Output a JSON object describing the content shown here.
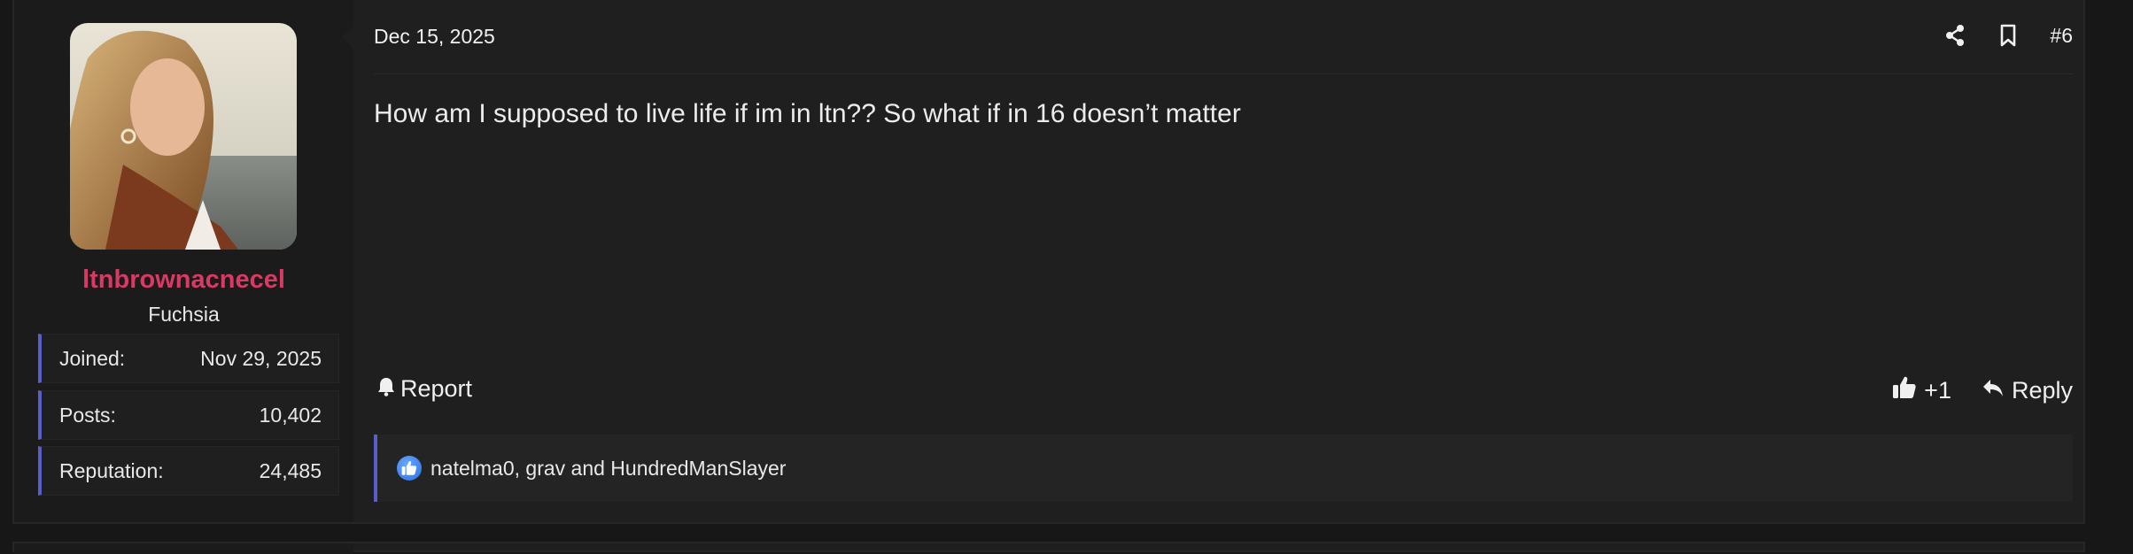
{
  "post": {
    "date": "Dec 15, 2025",
    "number": "#6",
    "body": "How am I supposed to live life if im in ltn?? So what if in 16 doesn’t matter",
    "actions": {
      "report_label": "Report",
      "like_label": "+1",
      "reply_label": "Reply"
    },
    "reactions_text": "natelma0, grav and HundredManSlayer"
  },
  "user": {
    "username": "ltnbrownacnecel",
    "title": "Fuchsia",
    "stats": [
      {
        "label": "Joined:",
        "value": "Nov 29, 2025"
      },
      {
        "label": "Posts:",
        "value": "10,402"
      },
      {
        "label": "Reputation:",
        "value": "24,485"
      }
    ]
  },
  "colors": {
    "username": "#d93a63",
    "accent_border": "#5a5ec9",
    "reaction_like": "#3a86f0"
  },
  "icons": [
    "share-icon",
    "bookmark-icon",
    "bell-icon",
    "thumbs-up-icon",
    "reply-icon",
    "like-reaction-icon"
  ]
}
